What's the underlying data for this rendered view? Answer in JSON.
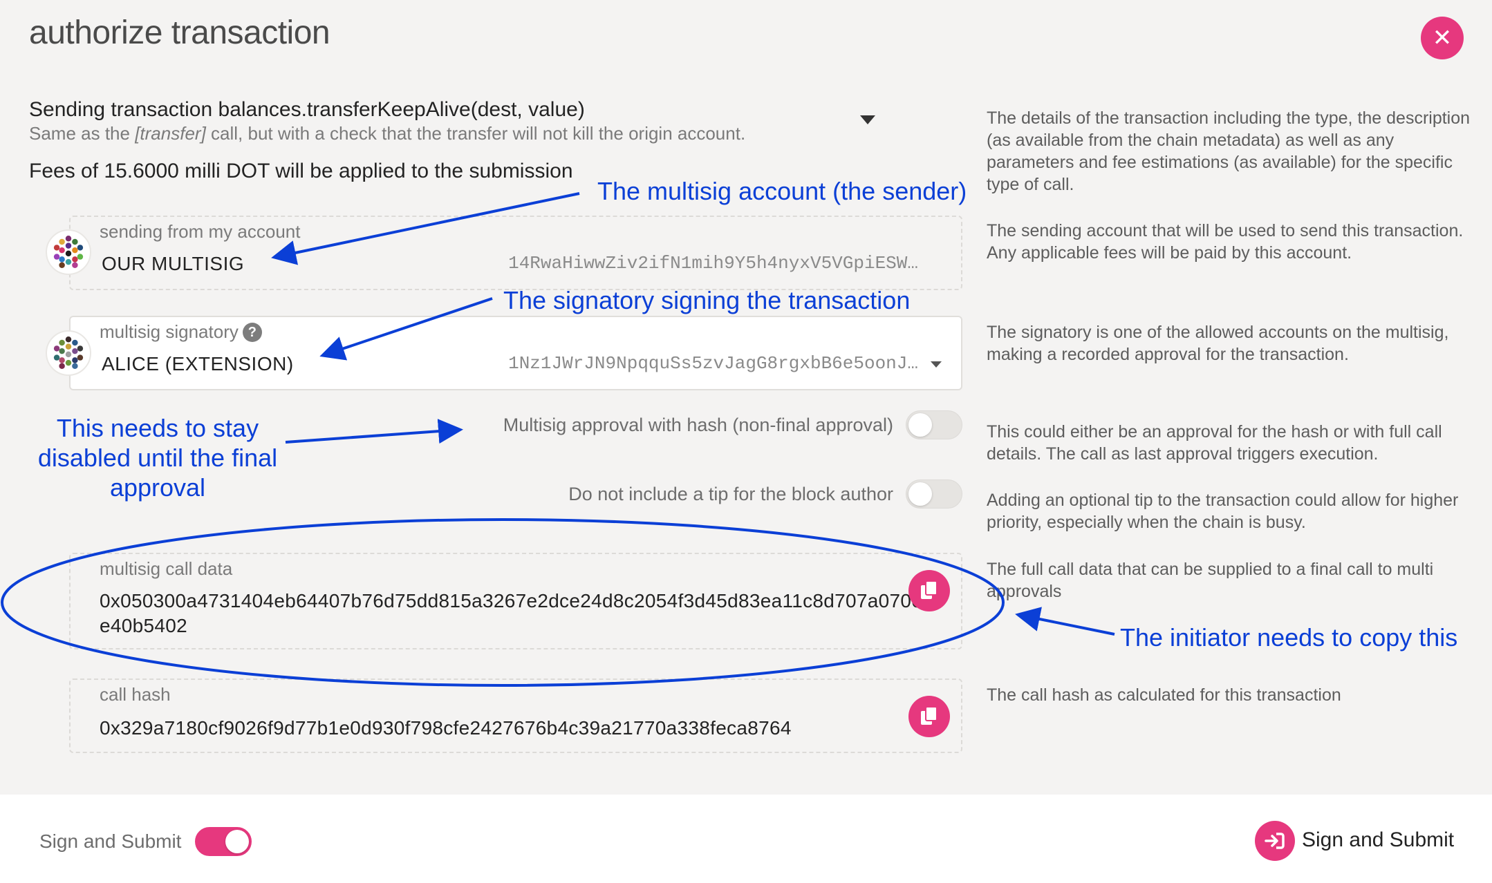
{
  "modal": {
    "title": "authorize transaction",
    "close_icon": "close-icon"
  },
  "transaction": {
    "title": "Sending transaction balances.transferKeepAlive(dest, value)",
    "desc_before": "Same as the ",
    "desc_italic": "[transfer]",
    "desc_after": " call, but with a check that the transfer will not kill the origin account.",
    "fees": "Fees of 15.6000 milli DOT will be applied to the submission",
    "help": "The details of the transaction including the type, the description (as available from the chain metadata) as well as any parameters and fee estimations (as available) for the specific type of call."
  },
  "sender": {
    "label": "sending from my account",
    "name": "OUR MULTISIG",
    "address": "14RwaHiwwZiv2ifN1mih9Y5h4nyxV5VGpiESW…",
    "help": "The sending account that will be used to send this transaction. Any applicable fees will be paid by this account."
  },
  "signatory": {
    "label": "multisig signatory",
    "help_icon": "?",
    "name": "ALICE (EXTENSION)",
    "address": "1Nz1JWrJN9NpqquSs5zvJagG8rgxbB6e5oonJ…",
    "help": "The signatory is one of the allowed accounts on the multisig, making a recorded approval for the transaction."
  },
  "toggles": {
    "approval_label": "Multisig approval with hash (non-final approval)",
    "approval_help": "This could either be an approval for the hash or with full call details. The call as last approval triggers execution.",
    "tip_label": "Do not include a tip for the block author",
    "tip_help": "Adding an optional tip to the transaction could allow for higher priority, especially when the chain is busy."
  },
  "call_data": {
    "label": "multisig call data",
    "value": "0x050300a4731404eb64407b76d75dd815a3267e2dce24d8c2054f3d45d83ea11c8d707a0700e40b5402",
    "help": "The full call data that can be supplied to a final call to multi approvals"
  },
  "call_hash": {
    "label": "call hash",
    "value": "0x329a7180cf9026f9d77b1e0d930f798cfe2427676b4c39a21770a338feca8764",
    "help": "The call hash as calculated for this transaction"
  },
  "footer": {
    "toggle_label": "Sign and Submit",
    "button_label": "Sign and Submit"
  },
  "annotations": {
    "sender": "The multisig account (the sender)",
    "signatory": "The signatory signing the transaction",
    "disabled_line1": "This needs to stay",
    "disabled_line2": "disabled until the final",
    "disabled_line3": "approval",
    "copy": "The initiator needs to copy this"
  },
  "colors": {
    "accent": "#e6387e",
    "annotation": "#0b3fd6",
    "background": "#f4f3f2"
  }
}
